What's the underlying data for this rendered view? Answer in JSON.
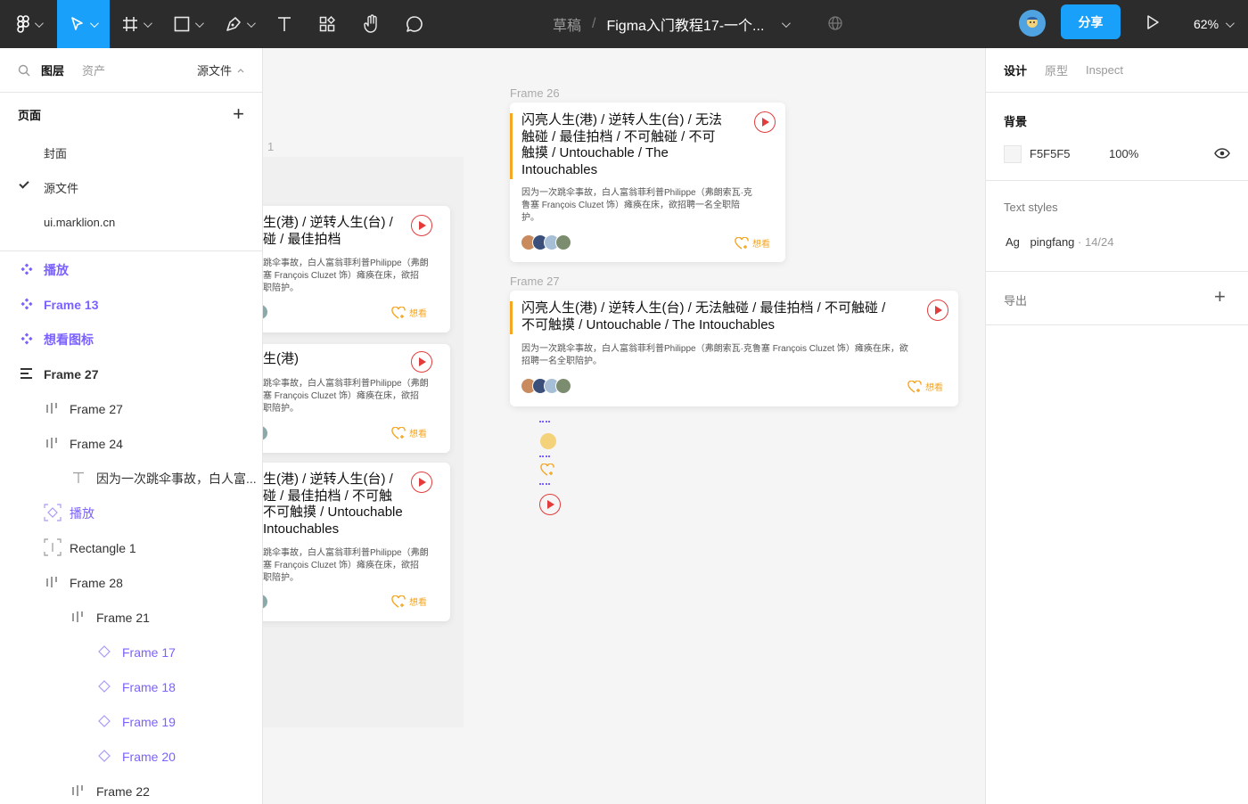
{
  "toolbar": {
    "draft": "草稿",
    "file_title": "Figma入门教程17-一个...",
    "share": "分享",
    "zoom": "62%"
  },
  "left_panel": {
    "tabs": [
      "图层",
      "资产"
    ],
    "page_selector": "源文件",
    "pages_title": "页面",
    "pages": [
      "封面",
      "源文件",
      "ui.marklion.cn"
    ],
    "layers": [
      {
        "label": "播放",
        "type": "component"
      },
      {
        "label": "Frame 13",
        "type": "component"
      },
      {
        "label": "想看图标",
        "type": "component"
      },
      {
        "label": "Frame 27",
        "type": "frame-vertical"
      },
      {
        "label": "Frame 27",
        "type": "frame-horizontal"
      },
      {
        "label": "Frame 24",
        "type": "frame-horizontal"
      },
      {
        "label": "因为一次跳伞事故，白人富...",
        "type": "text"
      },
      {
        "label": "播放",
        "type": "instance"
      },
      {
        "label": "Rectangle 1",
        "type": "rectangle"
      },
      {
        "label": "Frame 28",
        "type": "frame-horizontal"
      },
      {
        "label": "Frame 21",
        "type": "frame-horizontal"
      },
      {
        "label": "Frame 17",
        "type": "instance"
      },
      {
        "label": "Frame 18",
        "type": "instance"
      },
      {
        "label": "Frame 19",
        "type": "instance"
      },
      {
        "label": "Frame 20",
        "type": "instance"
      },
      {
        "label": "Frame 22",
        "type": "frame-horizontal"
      }
    ]
  },
  "canvas": {
    "partial_frame_label": "1",
    "frame26_label": "Frame 26",
    "frame27_label": "Frame 27",
    "want_label": "想看",
    "cards_left": [
      {
        "title": "生(港) / 逆转人生(台) /\n碰 / 最佳拍档",
        "desc": "跳伞事故，白人富翁菲利普Philippe（弗朗\n塞 François Cluzet 饰）瘫痪在床，欲招\n职陪护。"
      },
      {
        "title": "生(港)",
        "desc": "跳伞事故，白人富翁菲利普Philippe（弗朗\n塞 François Cluzet 饰）瘫痪在床，欲招\n职陪护。"
      },
      {
        "title": "生(港) / 逆转人生(台) /\n碰 / 最佳拍档 / 不可触\n不可触摸 / Untouchable\nIntouchables",
        "desc": "跳伞事故，白人富翁菲利普Philippe（弗朗\n塞 François Cluzet 饰）瘫痪在床，欲招\n职陪护。"
      }
    ],
    "card26": {
      "title": "闪亮人生(港) / 逆转人生(台) / 无法\n触碰 / 最佳拍档 / 不可触碰 / 不可\n触摸 / Untouchable / The\nIntouchables",
      "desc": "因为一次跳伞事故，白人富翁菲利普Philippe（弗朗索瓦·克\n鲁塞 François Cluzet 饰）瘫痪在床，欲招聘一名全职陪\n护。"
    },
    "card27": {
      "title": "闪亮人生(港) / 逆转人生(台) / 无法触碰 / 最佳拍档 / 不可触碰 /\n不可触摸 / Untouchable / The Intouchables",
      "desc": "因为一次跳伞事故，白人富翁菲利普Philippe（弗朗索瓦·克鲁塞 François Cluzet 饰）瘫痪在床，欲\n招聘一名全职陪护。"
    }
  },
  "right_panel": {
    "tabs": [
      "设计",
      "原型",
      "Inspect"
    ],
    "background_title": "背景",
    "bg_hex": "F5F5F5",
    "bg_opacity": "100%",
    "text_styles_title": "Text styles",
    "text_style_ag": "Ag",
    "text_style_name": "pingfang",
    "text_style_size": " · 14/24",
    "export_title": "导出"
  },
  "colors": {
    "accent": "#18a0fb",
    "component": "#7b61ff",
    "play_red": "#e23c3c",
    "want_orange": "#f5a623"
  }
}
